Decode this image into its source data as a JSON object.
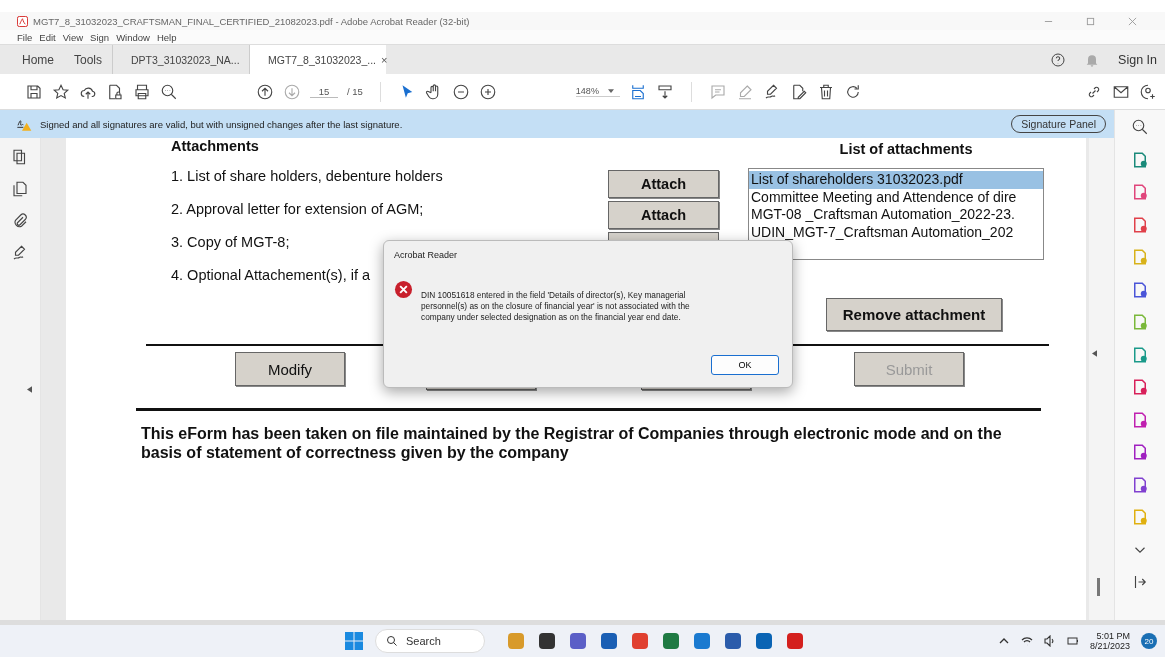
{
  "window": {
    "title": "MGT7_8_31032023_CRAFTSMAN_FINAL_CERTIFIED_21082023.pdf - Adobe Acrobat Reader (32-bit)"
  },
  "menu": [
    "File",
    "Edit",
    "View",
    "Sign",
    "Window",
    "Help"
  ],
  "tabs": [
    {
      "label": "Home",
      "kind": "nav",
      "selected": false
    },
    {
      "label": "Tools",
      "kind": "nav",
      "selected": false
    },
    {
      "label": "DPT3_31032023_NA...",
      "kind": "doc",
      "selected": false
    },
    {
      "label": "MGT7_8_31032023_...",
      "kind": "doc",
      "selected": true,
      "close": "×"
    }
  ],
  "sign_in": "Sign In",
  "toolbar": {
    "page": "15",
    "page_total": "/ 15",
    "zoom": "148%"
  },
  "signature_bar": {
    "message": "Signed and all signatures are valid, but with unsigned changes after the last signature.",
    "button": "Signature Panel"
  },
  "form": {
    "heading": "Attachments",
    "list_heading": "List of attachments",
    "items": [
      "1. List of share holders, debenture holders",
      "2. Approval letter for extension of AGM;",
      "3. Copy of MGT-8;",
      "4. Optional Attachement(s), if a"
    ],
    "attach_buttons": [
      "Attach",
      "Attach"
    ],
    "attachments": [
      {
        "name": "List of shareholders 31032023.pdf",
        "selected": true
      },
      {
        "name": "Committee Meeting and Attendence of dire",
        "selected": false
      },
      {
        "name": "MGT-08 _Craftsman Automation_2022-23.",
        "selected": false
      },
      {
        "name": "UDIN_MGT-7_Craftsman Automation_202",
        "selected": false
      }
    ],
    "remove_button": "Remove attachment",
    "actions": [
      {
        "label": "Modify",
        "disabled": false
      },
      {
        "label": "Submit",
        "disabled": true
      }
    ],
    "footer": "This eForm has been taken on file maintained by the Registrar of Companies through electronic mode and on the basis of statement of correctness given by the company"
  },
  "dialog": {
    "title": "Acrobat Reader",
    "message": "DIN 10051618 entered in the field 'Details of director(s), Key managerial personnel(s) as on the closure of financial year' is not associated with the company under selected designation as on the financial year end date.",
    "ok": "OK"
  },
  "taskbar": {
    "search_placeholder": "Search",
    "time": "5:01 PM",
    "date": "8/21/2023",
    "notifications": "20"
  }
}
